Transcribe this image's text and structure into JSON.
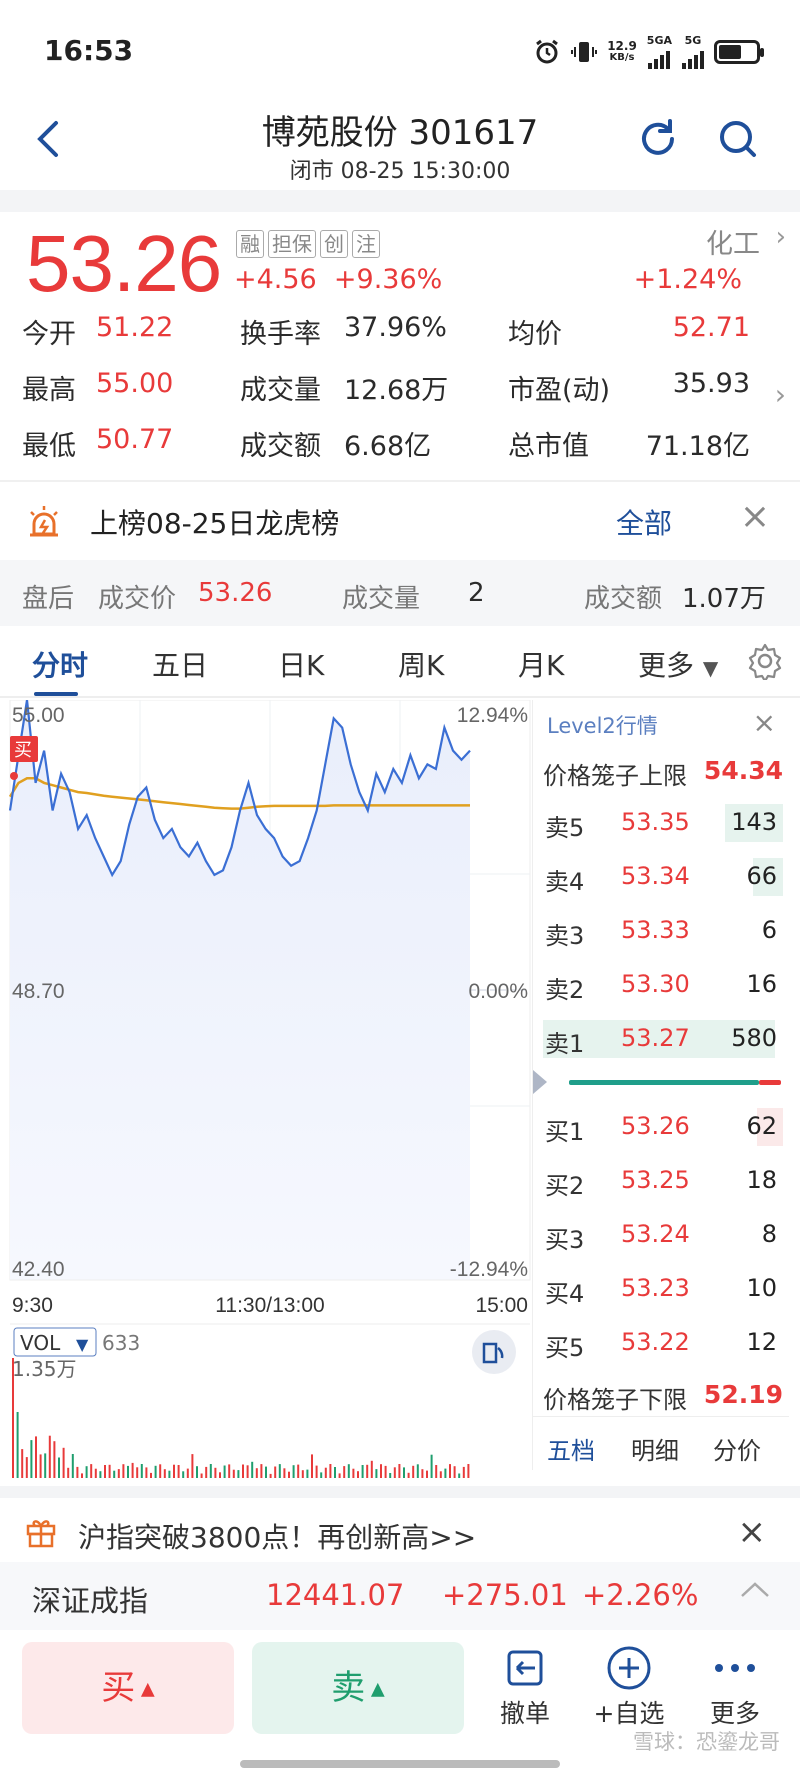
{
  "status_bar": {
    "time": "16:53",
    "net_speed": "12.9",
    "net_unit": "KB/s",
    "sim1": "5GA",
    "sim2": "5G"
  },
  "header": {
    "title": "博苑股份 301617",
    "subtitle": "闭市 08-25 15:30:00"
  },
  "quote": {
    "price": "53.26",
    "tags": [
      "融",
      "担保",
      "创",
      "注"
    ],
    "change": "+4.56",
    "change_pct": "+9.36%",
    "sector": "化工",
    "sector_change": "+1.24%",
    "stats": [
      [
        {
          "label": "今开",
          "value": "51.22",
          "color": "red"
        },
        {
          "label": "换手率",
          "value": "37.96%",
          "color": "dark"
        },
        {
          "label": "均价",
          "value": "52.71",
          "color": "red"
        }
      ],
      [
        {
          "label": "最高",
          "value": "55.00",
          "color": "red"
        },
        {
          "label": "成交量",
          "value": "12.68万",
          "color": "dark"
        },
        {
          "label": "市盈(动)",
          "value": "35.93",
          "color": "dark"
        }
      ],
      [
        {
          "label": "最低",
          "value": "50.77",
          "color": "red"
        },
        {
          "label": "成交额",
          "value": "6.68亿",
          "color": "dark"
        },
        {
          "label": "总市值",
          "value": "71.18亿",
          "color": "dark"
        }
      ]
    ]
  },
  "lhb": {
    "text": "上榜08-25日龙虎榜",
    "all_label": "全部"
  },
  "after_hours": {
    "label": "盘后",
    "price_label": "成交价",
    "price": "53.26",
    "vol_label": "成交量",
    "vol": "2",
    "amt_label": "成交额",
    "amt": "1.07万"
  },
  "tabs": [
    "分时",
    "五日",
    "日K",
    "周K",
    "月K",
    "更多"
  ],
  "chart": {
    "y_top": "55.00",
    "y_mid": "48.70",
    "y_bot": "42.40",
    "pct_top": "12.94%",
    "pct_mid": "0.00%",
    "pct_bot": "-12.94%",
    "x_start": "9:30",
    "x_mid": "11:30/13:00",
    "x_end": "15:00",
    "buy_marker": "买",
    "vol_label": "VOL",
    "vol_value": "633",
    "vol_max": "1.35万",
    "colors": {
      "price_line": "#3b6fd4",
      "avg_line": "#e0a020",
      "fill": "#eef2fc"
    }
  },
  "level2": {
    "title": "Level2行情",
    "upper_label": "价格笼子上限",
    "upper": "54.34",
    "lower_label": "价格笼子下限",
    "lower": "52.19",
    "asks": [
      {
        "label": "卖5",
        "price": "53.35",
        "vol": "143"
      },
      {
        "label": "卖4",
        "price": "53.34",
        "vol": "66"
      },
      {
        "label": "卖3",
        "price": "53.33",
        "vol": "6"
      },
      {
        "label": "卖2",
        "price": "53.30",
        "vol": "16"
      },
      {
        "label": "卖1",
        "price": "53.27",
        "vol": "580"
      }
    ],
    "bids": [
      {
        "label": "买1",
        "price": "53.26",
        "vol": "62"
      },
      {
        "label": "买2",
        "price": "53.25",
        "vol": "18"
      },
      {
        "label": "买3",
        "price": "53.24",
        "vol": "8"
      },
      {
        "label": "买4",
        "price": "53.23",
        "vol": "10"
      },
      {
        "label": "买5",
        "price": "53.22",
        "vol": "12"
      }
    ],
    "sub_tabs": [
      "五档",
      "明细",
      "分价"
    ]
  },
  "promo": {
    "text": "沪指突破3800点！再创新高>>"
  },
  "index_bar": {
    "name": "深证成指",
    "value": "12441.07",
    "change": "+275.01",
    "change_pct": "+2.26%"
  },
  "bottom": {
    "buy": "买",
    "sell": "卖",
    "cancel": "撤单",
    "watch": "+自选",
    "more": "更多"
  },
  "watermark": "雪球：恐鎏龙哥"
}
